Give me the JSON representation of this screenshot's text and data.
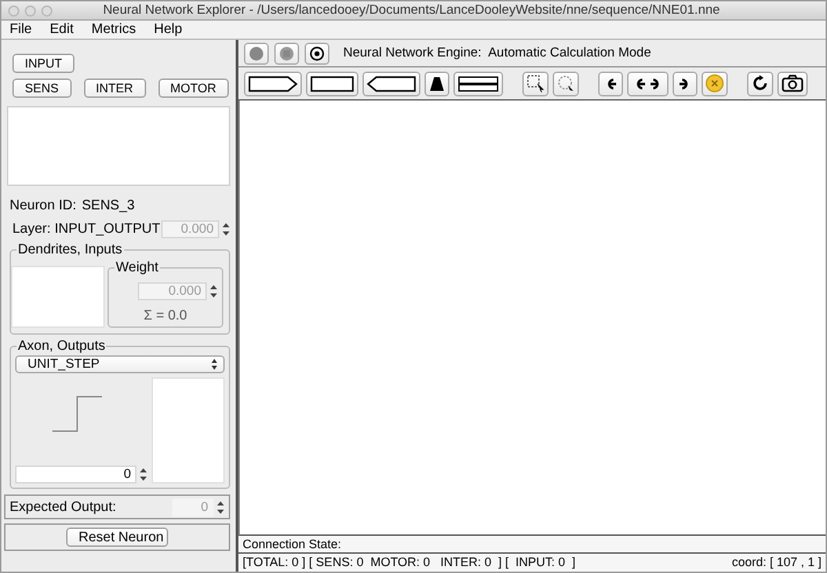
{
  "window": {
    "title": "Neural Network Explorer - /Users/lancedooey/Documents/LanceDooleyWebsite/nne/sequence/NNE01.nne"
  },
  "menu": [
    "File",
    "Edit",
    "Metrics",
    "Help"
  ],
  "neuron_button_rows": [
    [
      "INPUT"
    ],
    [
      "SENS",
      "INTER",
      "MOTOR"
    ]
  ],
  "neuron": {
    "id_label": "Neuron ID:",
    "id": "SENS_3",
    "layer": "Layer: INPUT_OUTPUT",
    "layer_value": "0.000",
    "layer_disabled": true
  },
  "dendrites": {
    "title": "Dendrites, Inputs",
    "weight_title": "Weight",
    "weight_value": "0.000",
    "weight_disabled": true,
    "sum": "Σ = 0.0"
  },
  "axon": {
    "title": "Axon, Outputs",
    "function": "UNIT_STEP",
    "value": "0",
    "value_disabled": false
  },
  "expected_output": {
    "label": "Expected Output:",
    "value": "0",
    "disabled": true
  },
  "reset_button": "Reset Neuron",
  "engine": {
    "label": "Neural Network Engine:  Automatic Calculation Mode"
  },
  "connection_state": "Connection State:",
  "status": {
    "counts": "[TOTAL: 0 ] [ SENS: 0  MOTOR: 0   INTER: 0  ] [  INPUT: 0  ]",
    "coord": "coord: [ 107 , 1 ]"
  }
}
